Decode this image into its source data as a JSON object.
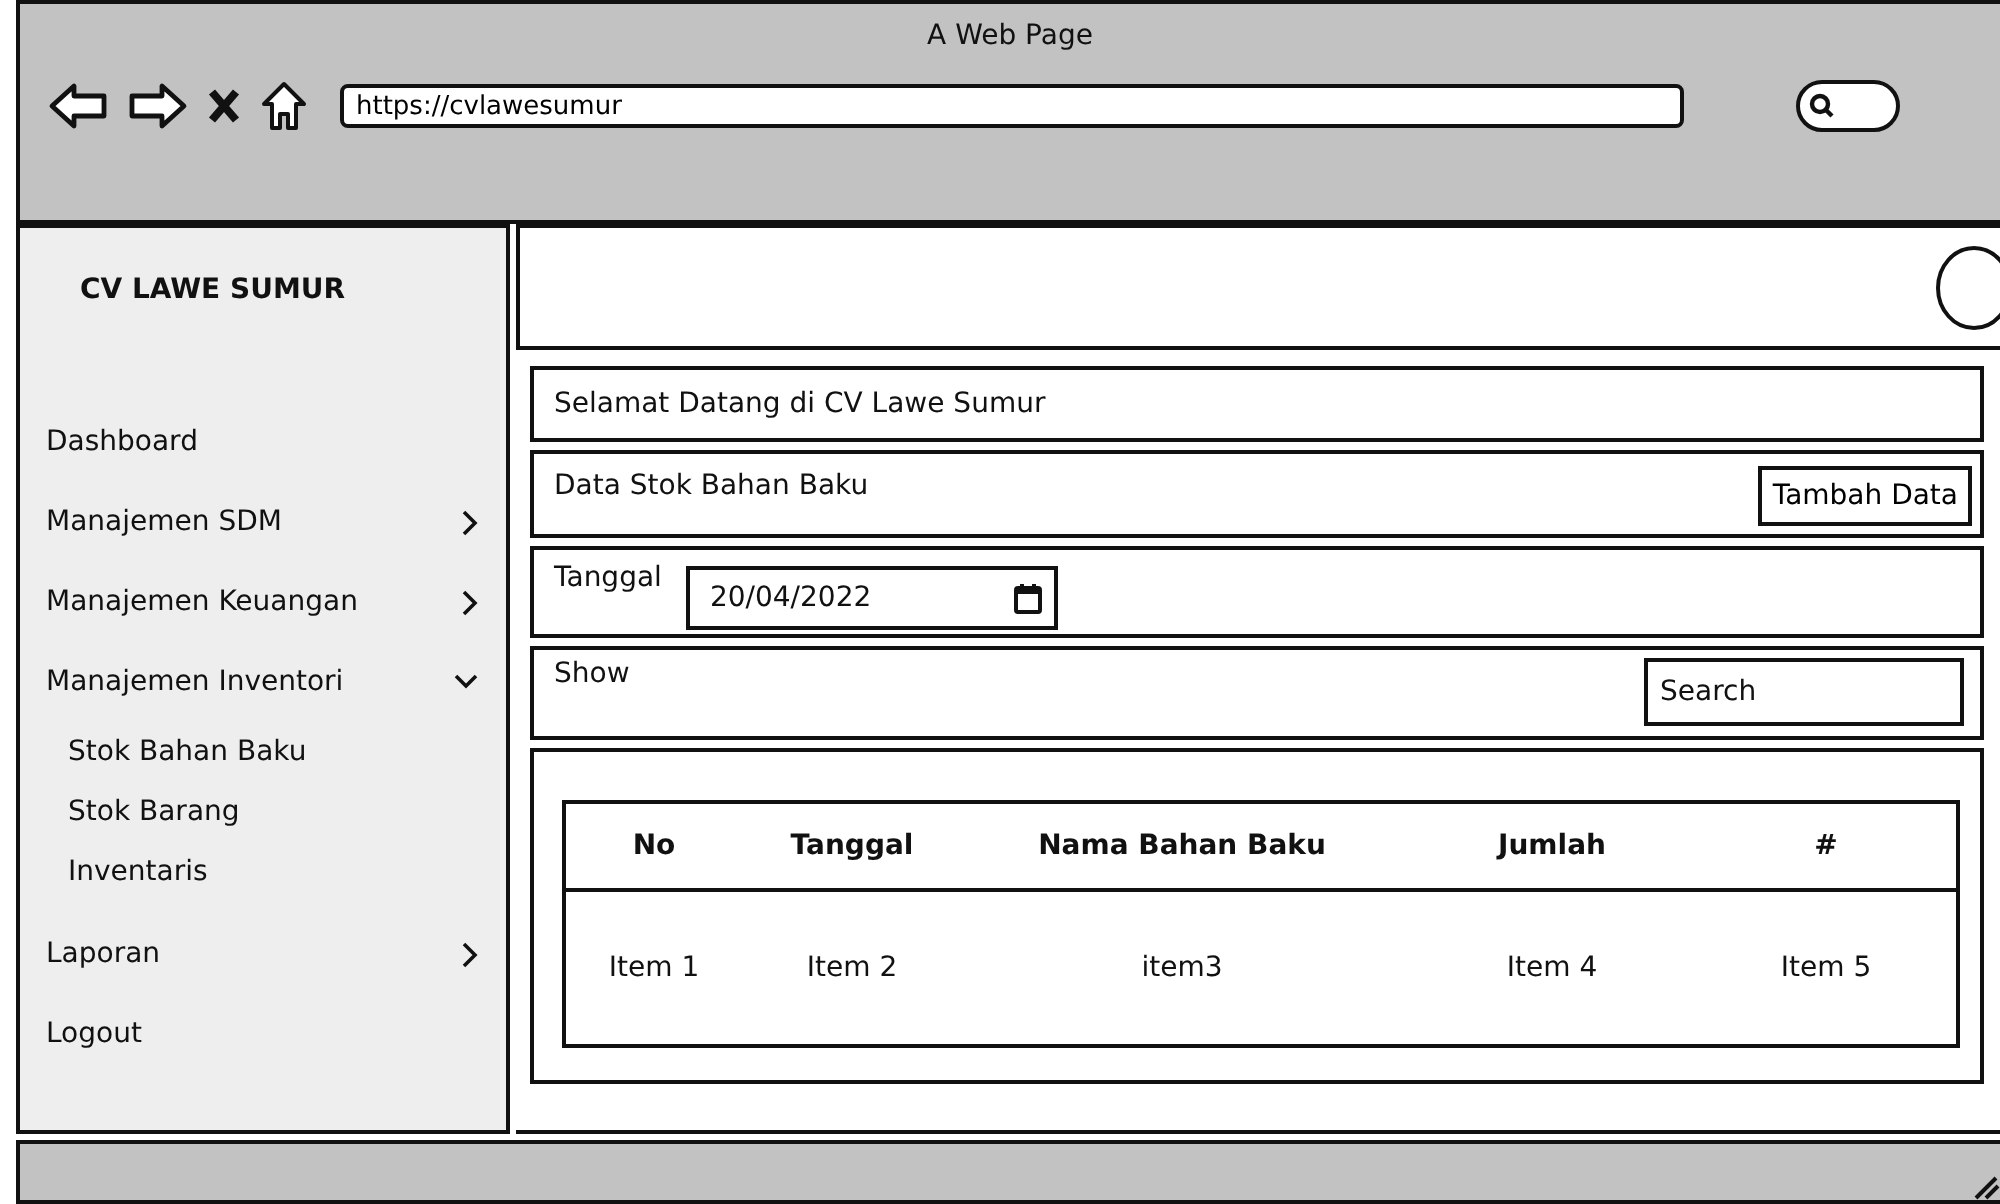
{
  "window": {
    "title": "A Web Page"
  },
  "address_bar": {
    "value": "https://cvlawesumur"
  },
  "sidebar": {
    "brand": "CV LAWE SUMUR",
    "items": [
      {
        "label": "Dashboard",
        "kind": "link"
      },
      {
        "label": "Manajemen SDM",
        "kind": "menu",
        "expanded": false
      },
      {
        "label": "Manajemen Keuangan",
        "kind": "menu",
        "expanded": false
      },
      {
        "label": "Manajemen Inventori",
        "kind": "menu",
        "expanded": true,
        "children": [
          {
            "label": "Stok Bahan Baku"
          },
          {
            "label": "Stok Barang"
          },
          {
            "label": "Inventaris"
          }
        ]
      },
      {
        "label": "Laporan",
        "kind": "menu",
        "expanded": false
      },
      {
        "label": "Logout",
        "kind": "link"
      }
    ]
  },
  "content": {
    "welcome": "Selamat Datang di CV Lawe Sumur",
    "section_title": "Data Stok Bahan Baku",
    "add_button": "Tambah Data",
    "date_filter": {
      "label": "Tanggal",
      "value": "20/04/2022"
    },
    "show_label": "Show",
    "search": {
      "placeholder": "Search"
    },
    "table": {
      "columns": [
        "No",
        "Tanggal",
        "Nama Bahan Baku",
        "Jumlah",
        "#"
      ],
      "rows": [
        [
          "Item 1",
          "Item 2",
          "item3",
          "Item 4",
          "Item 5"
        ]
      ]
    }
  }
}
